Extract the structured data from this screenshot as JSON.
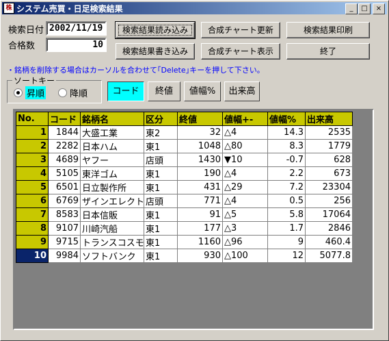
{
  "window": {
    "title": "システム売買・日足検索結果",
    "icon": "app-icon",
    "min": "_",
    "max": "□",
    "close": "×"
  },
  "form": {
    "date_label": "検索日付",
    "date_value": "2002/11/19",
    "count_label": "合格数",
    "count_value": "10"
  },
  "buttons": {
    "load": "検索結果読み込み",
    "save": "検索結果書き込み",
    "chart_update": "合成チャート更新",
    "chart_show": "合成チャート表示",
    "print": "検索結果印刷",
    "exit": "終了"
  },
  "hint": "・銘柄を削除する場合はカーソルを合わせて｢Delete｣キーを押して下さい。",
  "sort": {
    "title": "ソートキー",
    "asc": "昇順",
    "desc": "降順",
    "selected": "asc",
    "keys": [
      "コード",
      "終値",
      "値幅%",
      "出来高"
    ],
    "active_key": "コード"
  },
  "table": {
    "headers": [
      "No.",
      "コード",
      "銘柄名",
      "区分",
      "終値",
      "値幅+-",
      "値幅%",
      "出来高"
    ],
    "rows": [
      [
        "1",
        "1844",
        "大盛工業",
        "東2",
        "32",
        "△4",
        "14.3",
        "2535"
      ],
      [
        "2",
        "2282",
        "日本ハム",
        "東1",
        "1048",
        "△80",
        "8.3",
        "1779"
      ],
      [
        "3",
        "4689",
        "ヤフー",
        "店頭",
        "1430",
        "▼10",
        "-0.7",
        "628"
      ],
      [
        "4",
        "5105",
        "東洋ゴム",
        "東1",
        "190",
        "△4",
        "2.2",
        "673"
      ],
      [
        "5",
        "6501",
        "日立製作所",
        "東1",
        "431",
        "△29",
        "7.2",
        "23304"
      ],
      [
        "6",
        "6769",
        "ザインエレクト",
        "店頭",
        "771",
        "△4",
        "0.5",
        "256"
      ],
      [
        "7",
        "8583",
        "日本信販",
        "東1",
        "91",
        "△5",
        "5.8",
        "17064"
      ],
      [
        "8",
        "9107",
        "川崎汽船",
        "東1",
        "177",
        "△3",
        "1.7",
        "2846"
      ],
      [
        "9",
        "9715",
        "トランスコスモ",
        "東1",
        "1160",
        "△96",
        "9",
        "460.4"
      ],
      [
        "10",
        "9984",
        "ソフトバンク",
        "東1",
        "930",
        "△100",
        "12",
        "5077.8"
      ]
    ],
    "current_row": 9
  }
}
